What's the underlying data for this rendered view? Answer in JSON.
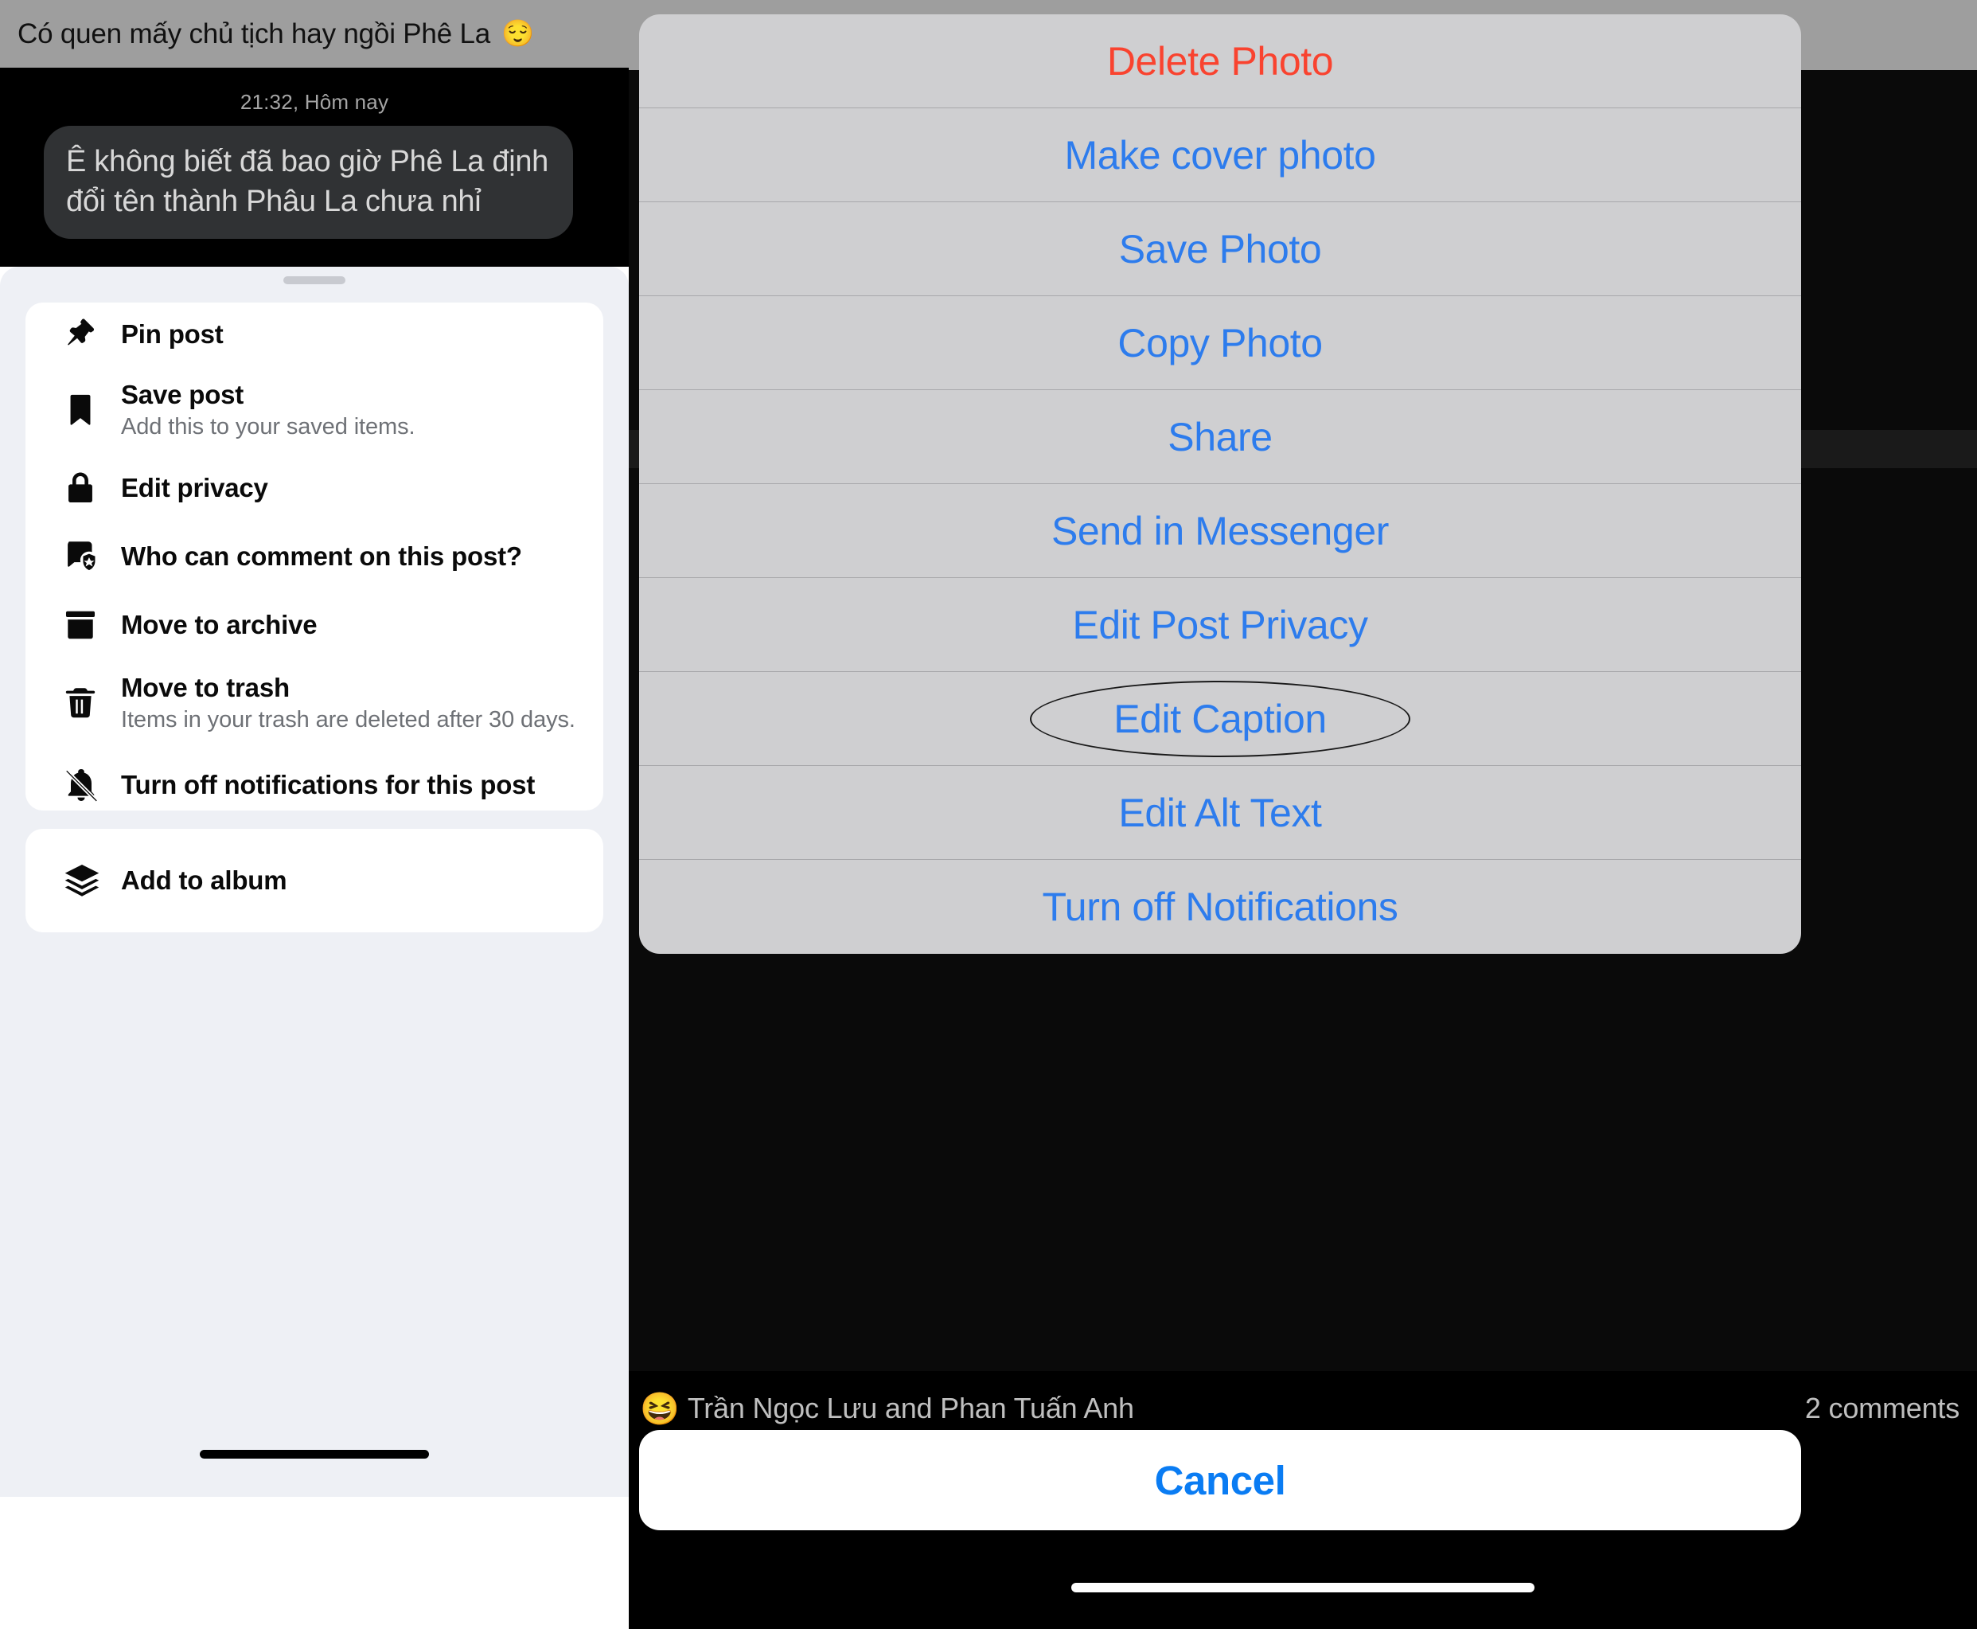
{
  "left_phone": {
    "chat": {
      "banner_text": "Có quen mấy chủ tịch hay ngồi Phê La",
      "banner_emoji": "😌",
      "timestamp": "21:32, Hôm nay",
      "message": "Ê không biết đã bao giờ Phê La định đổi tên thành Phâu La chưa nhỉ"
    },
    "sheet": {
      "main_items": [
        {
          "icon": "pin-icon",
          "title": "Pin post",
          "subtitle": ""
        },
        {
          "icon": "bookmark-icon",
          "title": "Save post",
          "subtitle": "Add this to your saved items."
        },
        {
          "icon": "lock-icon",
          "title": "Edit privacy",
          "subtitle": ""
        },
        {
          "icon": "comment-shield-icon",
          "title": "Who can comment on this post?",
          "subtitle": ""
        },
        {
          "icon": "archive-icon",
          "title": "Move to archive",
          "subtitle": ""
        },
        {
          "icon": "trash-icon",
          "title": "Move to trash",
          "subtitle": "Items in your trash are deleted after 30 days."
        },
        {
          "icon": "bell-slash-icon",
          "title": "Turn off notifications for this post",
          "subtitle": ""
        }
      ],
      "album_item": {
        "icon": "layers-icon",
        "title": "Add to album",
        "subtitle": ""
      }
    }
  },
  "right_phone": {
    "action_sheet": {
      "items": [
        {
          "label": "Delete Photo",
          "style": "destructive",
          "annotated": false
        },
        {
          "label": "Make cover photo",
          "style": "default",
          "annotated": false
        },
        {
          "label": "Save Photo",
          "style": "default",
          "annotated": false
        },
        {
          "label": "Copy Photo",
          "style": "default",
          "annotated": false
        },
        {
          "label": "Share",
          "style": "default",
          "annotated": false
        },
        {
          "label": "Send in Messenger",
          "style": "default",
          "annotated": false
        },
        {
          "label": "Edit Post Privacy",
          "style": "default",
          "annotated": false
        },
        {
          "label": "Edit Caption",
          "style": "default",
          "annotated": true
        },
        {
          "label": "Edit Alt Text",
          "style": "default",
          "annotated": false
        },
        {
          "label": "Turn off Notifications",
          "style": "default",
          "annotated": false
        }
      ],
      "cancel_label": "Cancel"
    },
    "post_meta": {
      "reaction_emoji": "😆",
      "names": "Trần Ngọc Lưu and Phan Tuấn Anh",
      "comments": "2 comments"
    }
  },
  "colors": {
    "destructive_red": "#f9432f",
    "action_blue": "#2d7ced",
    "cancel_blue": "#0a7cf3",
    "sheet_grey": "#cfcfd1",
    "sheet_bg": "#eef0f5"
  }
}
